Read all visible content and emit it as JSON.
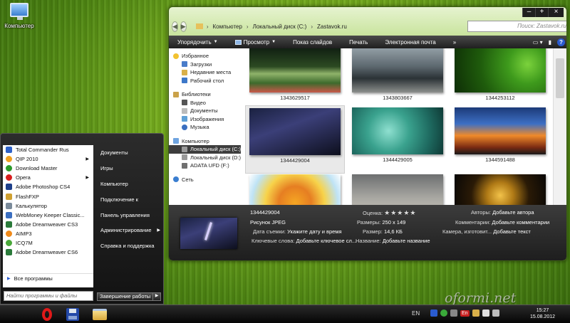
{
  "desktop": {
    "icon_label": "Компьютер"
  },
  "window": {
    "breadcrumb": [
      "Компьютер",
      "Локальный диск (C:)",
      "Zastavok.ru"
    ],
    "search_placeholder": "Поиск: Zastavok.ru",
    "caption": {
      "minimize": "–",
      "maximize": "+",
      "close": "×"
    },
    "toolbar": {
      "organize": "Упорядочить",
      "view": "Просмотр",
      "slideshow": "Показ слайдов",
      "print": "Печать",
      "email": "Электронная почта",
      "more": "»",
      "help": "?"
    },
    "nav": {
      "favorites": "Избранное",
      "downloads": "Загрузки",
      "recent": "Недавние места",
      "desktop": "Рабочий стол",
      "libraries": "Библиотеки",
      "video": "Видео",
      "documents": "Документы",
      "images": "Изображения",
      "music": "Музыка",
      "computer": "Компьютер",
      "local_c": "Локальный диск (C:)",
      "local_d": "Локальный диск (D:)",
      "usb": "ADATA UFD (F:)",
      "network": "Сеть"
    },
    "files": [
      {
        "name": "1343629517"
      },
      {
        "name": "1343803667"
      },
      {
        "name": "1344253112"
      },
      {
        "name": "1344429004"
      },
      {
        "name": "1344429005"
      },
      {
        "name": "1344591488"
      },
      {
        "name": ""
      },
      {
        "name": ""
      },
      {
        "name": ""
      }
    ],
    "details": {
      "filename": "1344429004",
      "type": "Рисунок JPEG",
      "date_label": "Дата съемки:",
      "date_value": "Укажите дату и время",
      "keywords_label": "Ключевые слова:",
      "keywords_value": "Добавьте ключевое сл...",
      "rating_label": "Оценка:",
      "rating_stars": "★★★★★",
      "dims_label": "Размеры:",
      "dims_value": "250 x 149",
      "size_label": "Размер:",
      "size_value": "14,6 КБ",
      "title_label": "Название:",
      "title_value": "Добавьте название",
      "authors_label": "Авторы:",
      "authors_value": "Добавьте автора",
      "comments_label": "Комментарии:",
      "comments_value": "Добавьте комментарии",
      "camera_label": "Камера, изготовит...",
      "camera_value": "Добавьте текст"
    }
  },
  "start_menu": {
    "programs": [
      "Total Commander Rus",
      "QIP 2010",
      "Download Master",
      "Opera",
      "Adobe Photoshop CS4",
      "FlashFXP",
      "Калькулятор",
      "WebMoney Keeper Classic...",
      "Adobe Dreamweaver CS3",
      "AIMP3",
      "ICQ7M",
      "Adobe Dreamweaver CS6"
    ],
    "all_programs": "Все программы",
    "right_items": [
      "Документы",
      "Игры",
      "Компьютер",
      "Подключение к",
      "Панель управления",
      "Администрирование",
      "Справка и поддержка"
    ],
    "search_placeholder": "Найти программы и файлы",
    "shutdown": "Завершение работы"
  },
  "taskbar": {
    "lang": "EN",
    "tray_label": "En",
    "time": "15:27",
    "date": "15.08.2012"
  },
  "watermark": "oformi.net"
}
